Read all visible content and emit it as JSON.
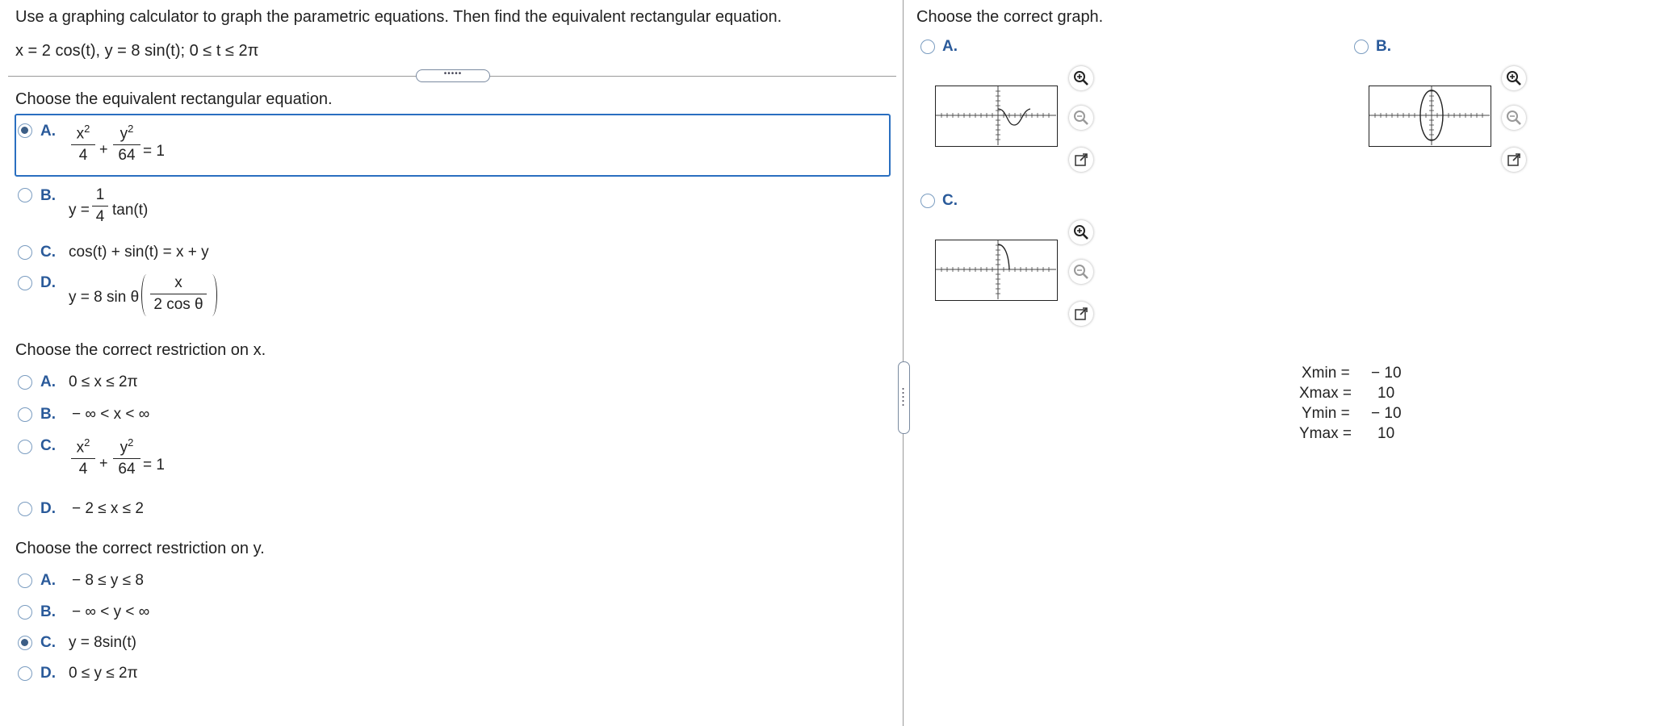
{
  "question": {
    "instruction": "Use a graphing calculator to graph the parametric equations. Then find the equivalent rectangular equation.",
    "equations": "x = 2 cos(t),  y = 8 sin(t);  0 ≤ t ≤ 2π"
  },
  "part1": {
    "prompt": "Choose the equivalent rectangular equation.",
    "options": [
      {
        "label": "A.",
        "x_num": "x",
        "x_exp": "2",
        "x_den": "4",
        "plus": "+",
        "y_num": "y",
        "y_exp": "2",
        "y_den": "64",
        "rhs": "= 1",
        "selected": true
      },
      {
        "label": "B.",
        "lhs": "y =",
        "num": "1",
        "den": "4",
        "rest": "tan(t)",
        "selected": false
      },
      {
        "label": "C.",
        "text": "cos(t) + sin(t) = x + y",
        "selected": false
      },
      {
        "label": "D.",
        "lhs": "y = 8 sin θ",
        "num": "x",
        "den": "2 cos θ",
        "selected": false
      }
    ]
  },
  "part2": {
    "prompt": "Choose the correct restriction on x.",
    "options": [
      {
        "label": "A.",
        "text": "0 ≤ x ≤ 2π",
        "selected": false
      },
      {
        "label": "B.",
        "text": "− ∞  <  x  <  ∞",
        "selected": false
      },
      {
        "label": "C.",
        "x_num": "x",
        "x_exp": "2",
        "x_den": "4",
        "plus": "+",
        "y_num": "y",
        "y_exp": "2",
        "y_den": "64",
        "rhs": "= 1",
        "selected": false
      },
      {
        "label": "D.",
        "text": "− 2 ≤ x ≤ 2",
        "selected": false
      }
    ]
  },
  "part3": {
    "prompt": "Choose the correct restriction on y.",
    "options": [
      {
        "label": "A.",
        "text": "− 8 ≤ y ≤ 8",
        "selected": false
      },
      {
        "label": "B.",
        "text": "− ∞  <  y  <  ∞",
        "selected": false
      },
      {
        "label": "C.",
        "text": "y = 8sin(t)",
        "selected": true
      },
      {
        "label": "D.",
        "text": "0 ≤ y ≤ 2π",
        "selected": false
      }
    ]
  },
  "graph_panel": {
    "prompt": "Choose the correct graph.",
    "options": [
      {
        "label": "A.",
        "shape": "wave",
        "selected": false
      },
      {
        "label": "B.",
        "shape": "ellipse",
        "selected": false
      },
      {
        "label": "C.",
        "shape": "arc",
        "selected": false
      }
    ],
    "icons": [
      "zoom-in-icon",
      "zoom-out-icon",
      "open-new-window-icon"
    ],
    "window": {
      "xmin_label": "Xmin =",
      "xmin": "− 10",
      "xmax_label": "Xmax =",
      "xmax": "10",
      "ymin_label": "Ymin =",
      "ymin": "− 10",
      "ymax_label": "Ymax =",
      "ymax": "10"
    }
  },
  "ui": {
    "collapse_dots": "•••••",
    "accent": "#2a6fc0",
    "label_color": "#2a5a9a"
  }
}
